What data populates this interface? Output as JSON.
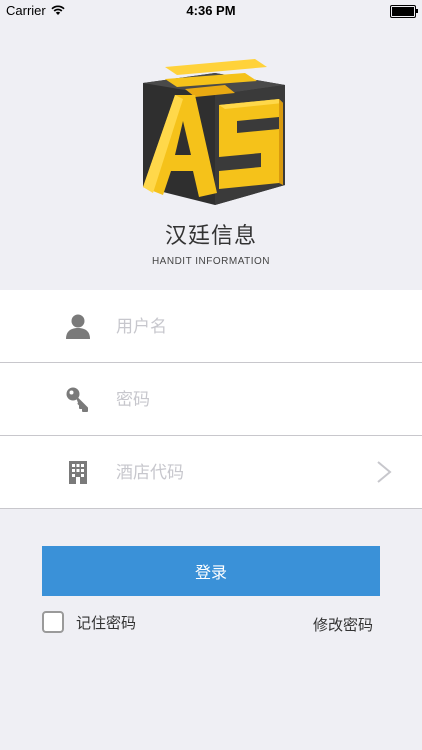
{
  "status_bar": {
    "carrier": "Carrier",
    "time": "4:36 PM",
    "battery_level": 1.0
  },
  "brand": {
    "name": "汉廷信息",
    "subtitle": "HANDIT INFORMATION",
    "logo_letters": "AS"
  },
  "form": {
    "username_placeholder": "用户名",
    "password_placeholder": "密码",
    "hotel_code_placeholder": "酒店代码",
    "icons": [
      "user-icon",
      "key-icon",
      "building-icon",
      "chevron-right-icon"
    ]
  },
  "actions": {
    "login_label": "登录",
    "remember_label": "记住密码",
    "remember_checked": false,
    "change_password_label": "修改密码"
  },
  "colors": {
    "background": "#efeff4",
    "primary": "#3a91d8",
    "logo_yellow": "#f5c21a",
    "logo_dark": "#3a3a3a"
  }
}
